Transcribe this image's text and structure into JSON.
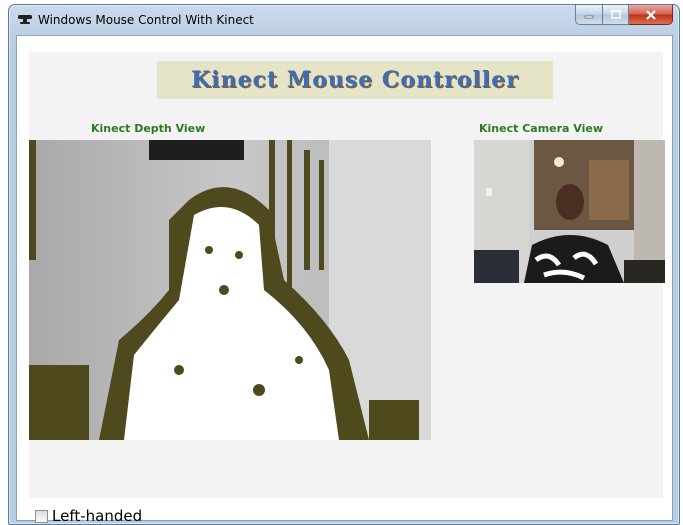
{
  "window": {
    "title": "Windows Mouse Control With Kinect",
    "buttons": [
      "minimize",
      "maximize",
      "close"
    ]
  },
  "banner": {
    "text": "Kinect Mouse Controller"
  },
  "labels": {
    "depth": "Kinect Depth View",
    "camera": "Kinect Camera View"
  },
  "options": {
    "left_handed_label": "Left-handed",
    "left_handed_checked": false
  },
  "colors": {
    "label_green": "#2b7a22",
    "depth_blob": "#4e4a1e",
    "panel_bg": "#f3f3f3"
  }
}
